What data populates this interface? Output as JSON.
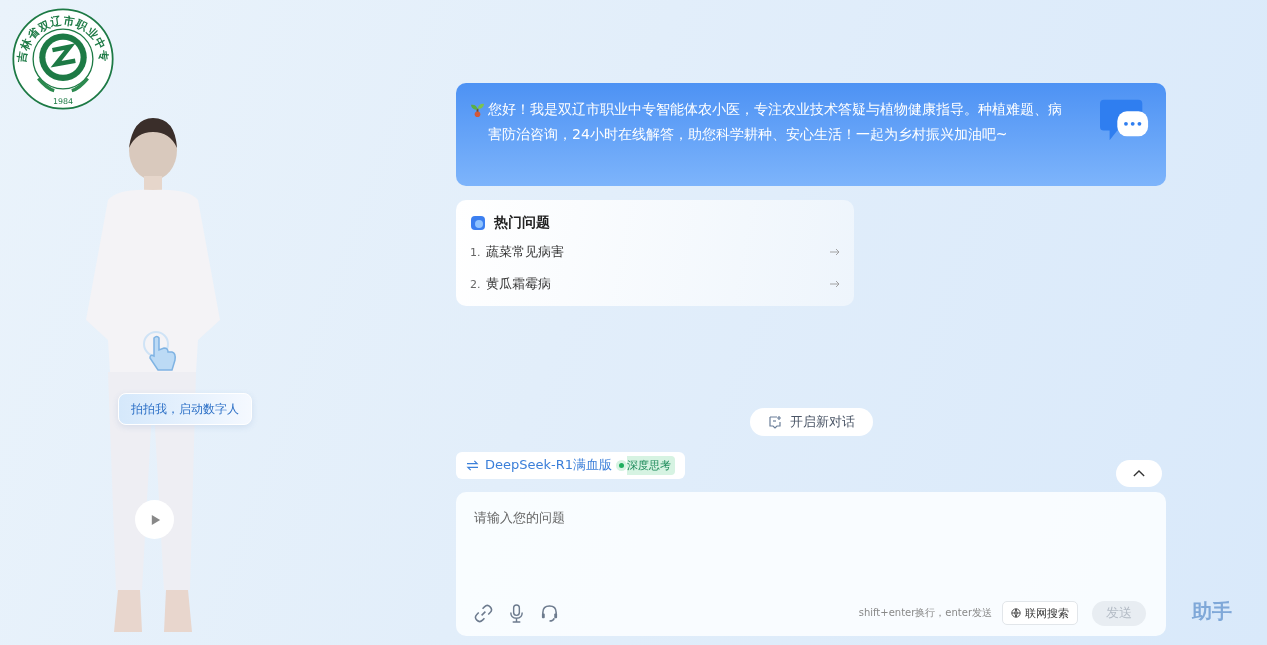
{
  "logo": {
    "ring_text": "吉林省双辽市职业中专",
    "year": "1984"
  },
  "avatar": {
    "tap_hint": "拍拍我，启动数字人"
  },
  "greeting": {
    "text": "您好！我是双辽市职业中专智能体农小医，专注农业技术答疑与植物健康指导。种植难题、病害防治咨询，24小时在线解答，助您科学耕种、安心生活！一起为乡村振兴加油吧~"
  },
  "hot_questions": {
    "title": "热门问题",
    "items": [
      {
        "number": "1.",
        "text": "蔬菜常见病害"
      },
      {
        "number": "2.",
        "text": "黄瓜霜霉病"
      }
    ]
  },
  "new_chat": {
    "label": "开启新对话"
  },
  "model": {
    "name": "DeepSeek-R1满血版",
    "tag": "深度思考"
  },
  "composer": {
    "placeholder": "请输入您的问题",
    "hint": "shift+enter换行，enter发送",
    "web_search": "联网搜索",
    "send": {
      "label": "发送",
      "disabled": true
    }
  },
  "decor_text": "助手"
}
